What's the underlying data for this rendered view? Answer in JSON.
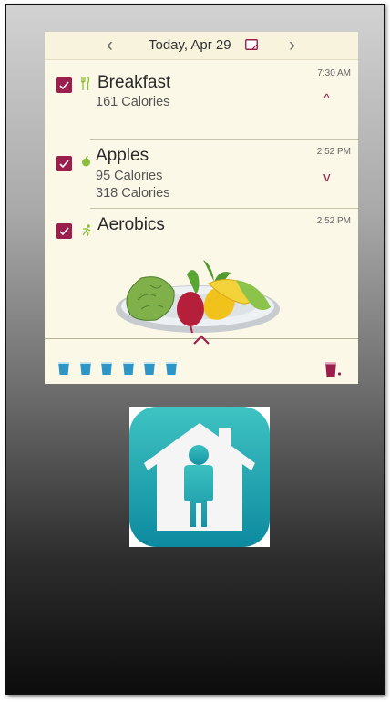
{
  "screen": {
    "header": {
      "prev_arrow": "‹",
      "date": "Today, Apr 29",
      "next_arrow": "›",
      "note_icon": "note-icon"
    },
    "entries": [
      {
        "title": "Breakfast",
        "calories": "161 Calories",
        "time": "7:30 AM",
        "icon": "fork-knife-icon",
        "chevron": "^",
        "checked": true
      },
      {
        "title": "Apples",
        "calories": "95 Calories",
        "calories_total": "318 Calories",
        "time": "2:52 PM",
        "icon": "apple-icon",
        "chevron": "v",
        "checked": true
      },
      {
        "title": "Aerobics",
        "time": "2:52 PM",
        "icon": "runner-icon",
        "checked": true
      }
    ],
    "tray": {
      "chevron": "^",
      "water_cups": 6,
      "add_icon": "add-red-cup-icon"
    },
    "colors": {
      "accent": "#9b1f4d",
      "background": "#fbf8e8",
      "water": "#2e96c6"
    }
  },
  "app_icon": {
    "name": "home-person-app-icon",
    "colors": {
      "top": "#3fc3c2",
      "bottom": "#0d8aa0"
    }
  }
}
